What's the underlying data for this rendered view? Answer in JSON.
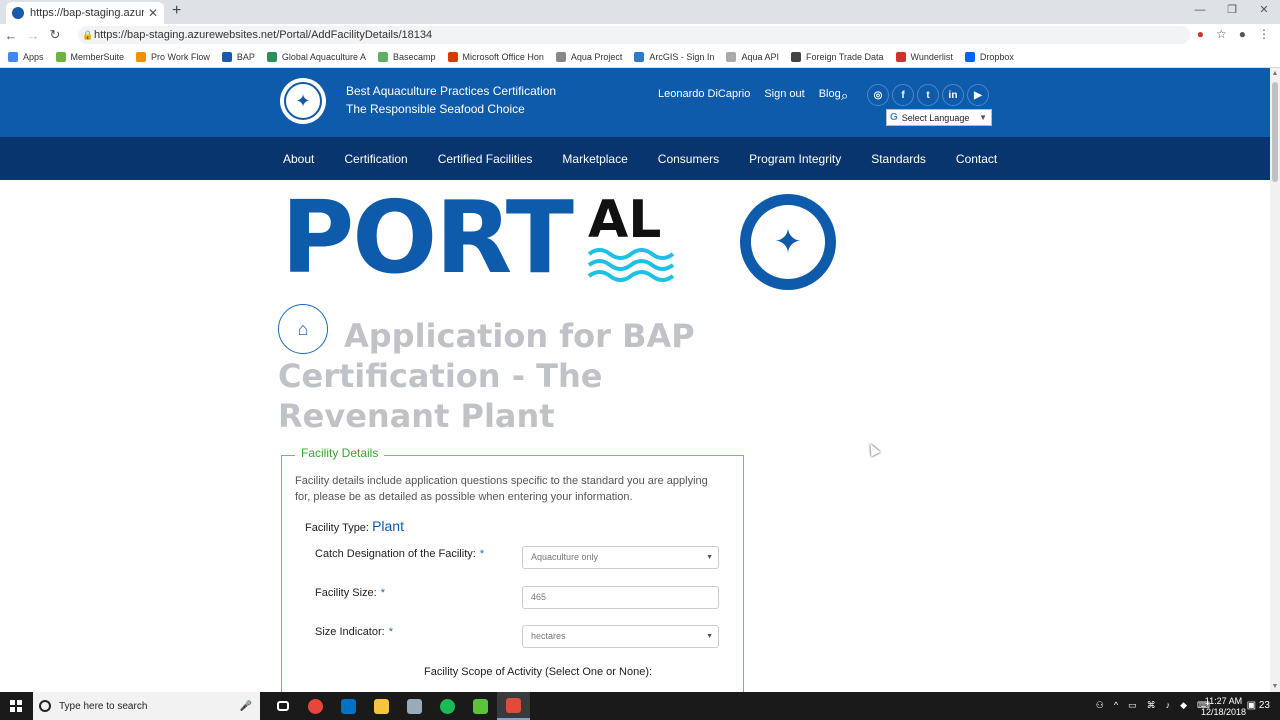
{
  "browser": {
    "tab_title": "https://bap-staging.azurewebsites",
    "url": "https://bap-staging.azurewebsites.net/Portal/AddFacilityDetails/18134",
    "bookmarks": [
      {
        "label": "Apps",
        "color": "#4285f4"
      },
      {
        "label": "MemberSuite",
        "color": "#6db33f"
      },
      {
        "label": "Pro Work Flow",
        "color": "#f29100"
      },
      {
        "label": "BAP",
        "color": "#1b5aa8"
      },
      {
        "label": "Global Aquaculture A",
        "color": "#2a8f5c"
      },
      {
        "label": "Basecamp",
        "color": "#5eb15e"
      },
      {
        "label": "Microsoft Office Hon",
        "color": "#d83b01"
      },
      {
        "label": "Aqua Project",
        "color": "#888888"
      },
      {
        "label": "ArcGIS - Sign In",
        "color": "#2c7ac9"
      },
      {
        "label": "Aqua API",
        "color": "#aaaaaa"
      },
      {
        "label": "Foreign Trade Data",
        "color": "#444444"
      },
      {
        "label": "Wunderlist",
        "color": "#d0312d"
      },
      {
        "label": "Dropbox",
        "color": "#0061ff"
      }
    ]
  },
  "site": {
    "brand_line1": "Best Aquaculture Practices Certification",
    "brand_line2": "The Responsible Seafood Choice",
    "user": "Leonardo DiCaprio",
    "signout": "Sign out",
    "blog": "Blog",
    "language": "Select Language",
    "social": [
      "instagram-icon",
      "facebook-icon",
      "twitter-icon",
      "linkedin-icon",
      "youtube-icon"
    ],
    "nav": [
      "About",
      "Certification",
      "Certified Facilities",
      "Marketplace",
      "Consumers",
      "Program Integrity",
      "Standards",
      "Contact"
    ]
  },
  "logo": {
    "portal_main": "PORT",
    "portal_al": "AL"
  },
  "page": {
    "title": "Application for BAP Certification - The Revenant Plant"
  },
  "form": {
    "legend": "Facility Details",
    "intro": "Facility details include application questions specific to the standard you are applying for, please be as detailed as possible when entering your information.",
    "facility_type_label": "Facility Type:",
    "facility_type_value": "Plant",
    "catch_label": "Catch Designation of the Facility:",
    "catch_value": "Aquaculture only",
    "size_label": "Facility Size:",
    "size_value": "465",
    "indicator_label": "Size Indicator:",
    "indicator_value": "hectares",
    "scope_label": "Facility Scope of Activity (Select One or None):",
    "required_mark": "*"
  },
  "taskbar": {
    "search_placeholder": "Type here to search",
    "time": "11:27 AM",
    "date": "12/18/2018",
    "notifications": "23",
    "apps": [
      {
        "name": "task-view",
        "color": "#ffffff"
      },
      {
        "name": "chrome",
        "color": "#e8453c"
      },
      {
        "name": "outlook",
        "color": "#0072c6"
      },
      {
        "name": "file-explorer",
        "color": "#f5c542"
      },
      {
        "name": "app",
        "color": "#9ab"
      },
      {
        "name": "spotify",
        "color": "#1db954"
      },
      {
        "name": "camtasia",
        "color": "#5ec33c"
      },
      {
        "name": "camtasia-recorder",
        "color": "#e04b3a"
      }
    ]
  },
  "colors": {
    "brand_blue": "#0f5bab",
    "nav_dark": "#08356e",
    "legend_green": "#3aa535"
  }
}
